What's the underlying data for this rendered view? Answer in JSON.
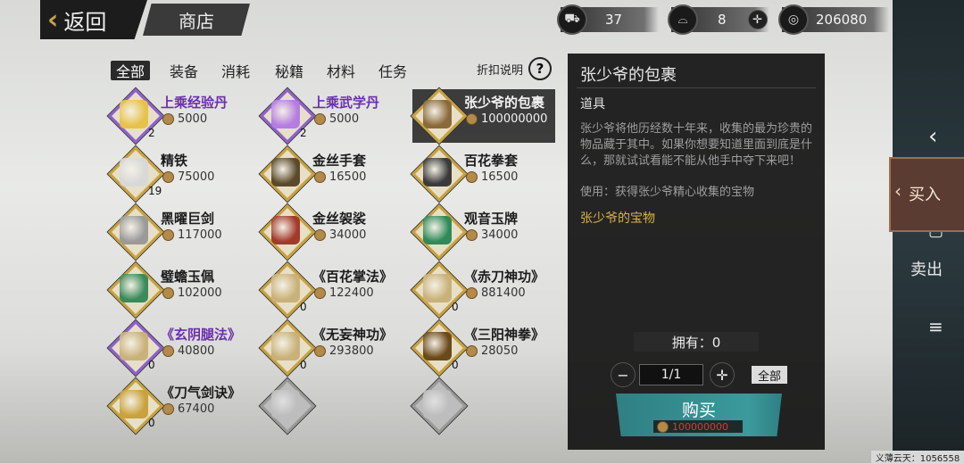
{
  "header": {
    "back_label": "返回",
    "shop_title": "商店",
    "resources": [
      {
        "icon": "cart-icon",
        "value": "37"
      },
      {
        "icon": "silver-ingot-icon",
        "value": "8"
      },
      {
        "icon": "coin-icon",
        "value": "206080"
      }
    ]
  },
  "tabs": [
    {
      "label": "全部",
      "active": true
    },
    {
      "label": "装备"
    },
    {
      "label": "消耗"
    },
    {
      "label": "秘籍"
    },
    {
      "label": "材料"
    },
    {
      "label": "任务"
    }
  ],
  "discount_label": "折扣说明",
  "items": [
    {
      "name": "上乘经验丹",
      "price": "5000",
      "count": "2",
      "rare": true
    },
    {
      "name": "上乘武学丹",
      "price": "5000",
      "count": "2",
      "rare": true
    },
    {
      "name": "张少爷的包裹",
      "price": "100000000",
      "selected": true
    },
    {
      "name": "精铁",
      "price": "75000",
      "count": "19"
    },
    {
      "name": "金丝手套",
      "price": "16500"
    },
    {
      "name": "百花拳套",
      "price": "16500"
    },
    {
      "name": "黑曜巨剑",
      "price": "117000"
    },
    {
      "name": "金丝袈裟",
      "price": "34000"
    },
    {
      "name": "观音玉牌",
      "price": "34000"
    },
    {
      "name": "璧蟾玉佩",
      "price": "102000"
    },
    {
      "name": "《百花掌法》",
      "price": "122400",
      "count": "0"
    },
    {
      "name": "《赤刀神功》",
      "price": "881400",
      "count": "0"
    },
    {
      "name": "《玄阴腿法》",
      "price": "40800",
      "count": "0",
      "rare": true
    },
    {
      "name": "《无妄神功》",
      "price": "293800",
      "count": "0"
    },
    {
      "name": "《三阳神拳》",
      "price": "28050",
      "count": "0"
    },
    {
      "name": "《刀气剑诀》",
      "price": "67400",
      "count": "0"
    },
    {
      "name": "",
      "price": ""
    },
    {
      "name": "",
      "price": ""
    }
  ],
  "detail": {
    "title": "张少爷的包裹",
    "type": "道具",
    "description": "张少爷将他历经数十年来，收集的最为珍贵的物品藏于其中。如果你想要知道里面到底是什么，那就试试看能不能从他手中夺下来吧！",
    "usage": "使用：获得张少爷精心收集的宝物",
    "gold_text": "张少爷的宝物",
    "owned_label": "拥有：0",
    "quantity": "1/1",
    "all_label": "全部",
    "buy_label": "购买",
    "buy_price": "100000000"
  },
  "side": {
    "buy_tab": "买入",
    "sell_tab": "卖出"
  },
  "footer": "义薄云天：1056558",
  "colors": {
    "accent_teal": "#3b9a9c",
    "gold": "#d8b24a",
    "rare_purple": "#6b2fae",
    "price_red": "#e03434"
  }
}
